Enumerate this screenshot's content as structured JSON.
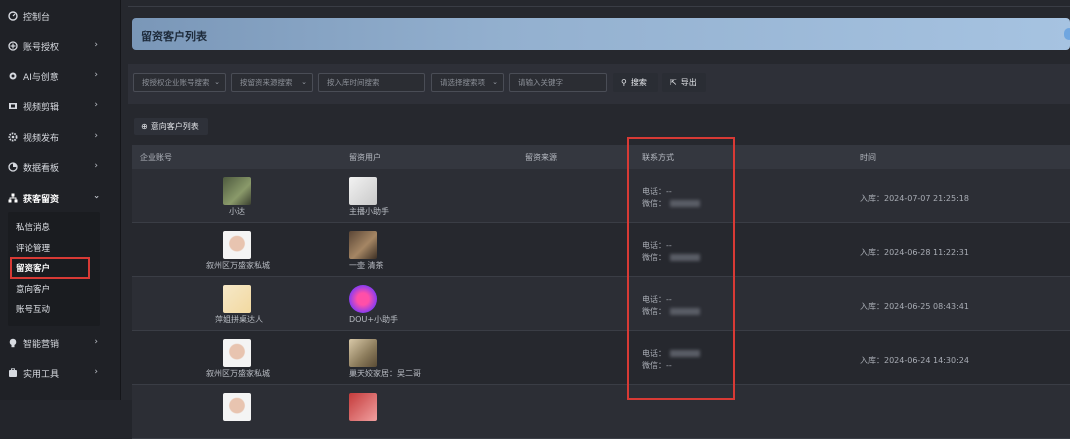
{
  "sidebar": {
    "items": [
      {
        "label": "控制台",
        "icon": "dashboard-icon",
        "chevron": false
      },
      {
        "label": "账号授权",
        "icon": "add-circle-icon",
        "chevron": true
      },
      {
        "label": "AI与创意",
        "icon": "ai-icon",
        "chevron": true
      },
      {
        "label": "视频剪辑",
        "icon": "film-icon",
        "chevron": true
      },
      {
        "label": "视频发布",
        "icon": "gear-icon",
        "chevron": true
      },
      {
        "label": "数据看板",
        "icon": "chart-icon",
        "chevron": true
      },
      {
        "label": "获客留资",
        "icon": "sitemap-icon",
        "chevron": true,
        "expanded": true
      },
      {
        "label": "智能营销",
        "icon": "bulb-icon",
        "chevron": true
      },
      {
        "label": "实用工具",
        "icon": "tools-icon",
        "chevron": true
      }
    ],
    "subitems": [
      "私信消息",
      "评论管理",
      "留资客户",
      "意向客户",
      "账号互动"
    ],
    "active_subitem": "留资客户"
  },
  "header": {
    "title": "留资客户列表"
  },
  "filters": {
    "account_placeholder": "按授权企业账号搜索",
    "source_placeholder": "按留资来源搜索",
    "time_placeholder": "按入库时间搜索",
    "search_type_placeholder": "请选择搜索项",
    "keyword_placeholder": "请输入关键字",
    "search_label": "搜索",
    "export_label": "导出"
  },
  "tab": {
    "label": "意向客户列表"
  },
  "table": {
    "headers": [
      "企业账号",
      "留资用户",
      "留资来源",
      "联系方式",
      "时间"
    ],
    "rows": [
      {
        "account": "小达",
        "user": "主播小助手",
        "source": "",
        "phone": "电话：--",
        "wechat": "微信：",
        "time": "入库：2024-07-07 21:25:18"
      },
      {
        "account": "叙州区万盛家私城",
        "user": "一壶 清茶",
        "source": "",
        "phone": "电话：--",
        "wechat": "微信：",
        "time": "入库：2024-06-28 11:22:31"
      },
      {
        "account": "萍姐拼桌达人",
        "user": "DOU+小助手",
        "source": "",
        "phone": "电话：--",
        "wechat": "微信：",
        "time": "入库：2024-06-25 08:43:41"
      },
      {
        "account": "叙州区万盛家私城",
        "user": "巢天姣家居：吴二哥",
        "source": "",
        "phone": "电话：",
        "wechat": "微信：--",
        "time": "入库：2024-06-24 14:30:24"
      }
    ]
  },
  "colors": {
    "highlight_border": "#d83a35",
    "header_gradient_start": "#7a97b8",
    "header_gradient_end": "#a6c3e1"
  }
}
